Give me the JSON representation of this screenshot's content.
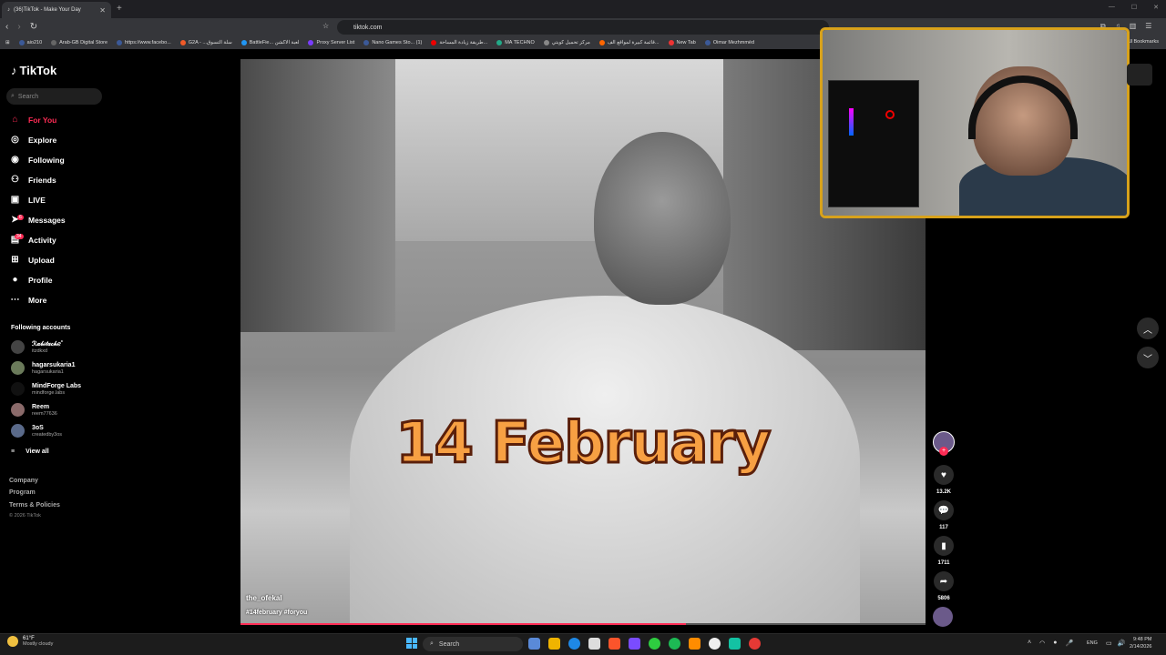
{
  "browser": {
    "tab_title": "(36)TikTok - Make Your Day",
    "url": "tiktok.com",
    "bookmarks": [
      "aio210",
      "Arab-GB Digital Store",
      "https://www.facebo...",
      "G2A - ...سلة التسوق",
      "BattleFie... لعبة الاكشن",
      "Proxy Server List",
      "Nano Games Sto... (1)",
      "طريقة زيادة المساحة...",
      "MA TECHNO",
      "مركز تحميل كويتي",
      "قائمة كبيرة لمواقع الف...",
      "New Tab",
      "Oimar Mezhmmèd"
    ],
    "all_bookmarks": "All Bookmarks"
  },
  "tiktok": {
    "logo": "TikTok",
    "search_placeholder": "Search",
    "nav": [
      {
        "label": "For You",
        "icon": "home-icon",
        "active": true
      },
      {
        "label": "Explore",
        "icon": "compass-icon"
      },
      {
        "label": "Following",
        "icon": "following-icon"
      },
      {
        "label": "Friends",
        "icon": "friends-icon"
      },
      {
        "label": "LIVE",
        "icon": "live-icon"
      },
      {
        "label": "Messages",
        "icon": "messages-icon",
        "badge": "6"
      },
      {
        "label": "Activity",
        "icon": "activity-icon",
        "badge": "34"
      },
      {
        "label": "Upload",
        "icon": "upload-icon"
      },
      {
        "label": "Profile",
        "icon": "profile-icon"
      },
      {
        "label": "More",
        "icon": "more-icon"
      }
    ],
    "following_title": "Following accounts",
    "accounts": [
      {
        "name": "ℛ𝒶𝒷𝒾𝓉𝒶𝒸𝒽ℯ˚",
        "user": "itzdkxd"
      },
      {
        "name": "hagarsukaria1",
        "user": "hagarsukaria1"
      },
      {
        "name": "MindForge Labs",
        "user": "mindforge.labs"
      },
      {
        "name": "Reem",
        "user": "reem77636"
      },
      {
        "name": "3oS",
        "user": "createdby3os"
      }
    ],
    "view_all": "View all",
    "footer": [
      "Company",
      "Program",
      "Terms & Policies"
    ],
    "copyright": "© 2026 TikTok",
    "video": {
      "overlay_text": "14 February",
      "author": "the_ofekal",
      "tags": "#14february #foryou",
      "progress": 0.65
    },
    "actions": {
      "likes": "13.2K",
      "comments": "117",
      "saves": "1711",
      "shares": "5806"
    }
  },
  "taskbar": {
    "weather_temp": "61°F",
    "weather_desc": "Mostly cloudy",
    "search": "Search",
    "lang": "ENG",
    "time": "9:48 PM",
    "date": "2/14/2026"
  }
}
